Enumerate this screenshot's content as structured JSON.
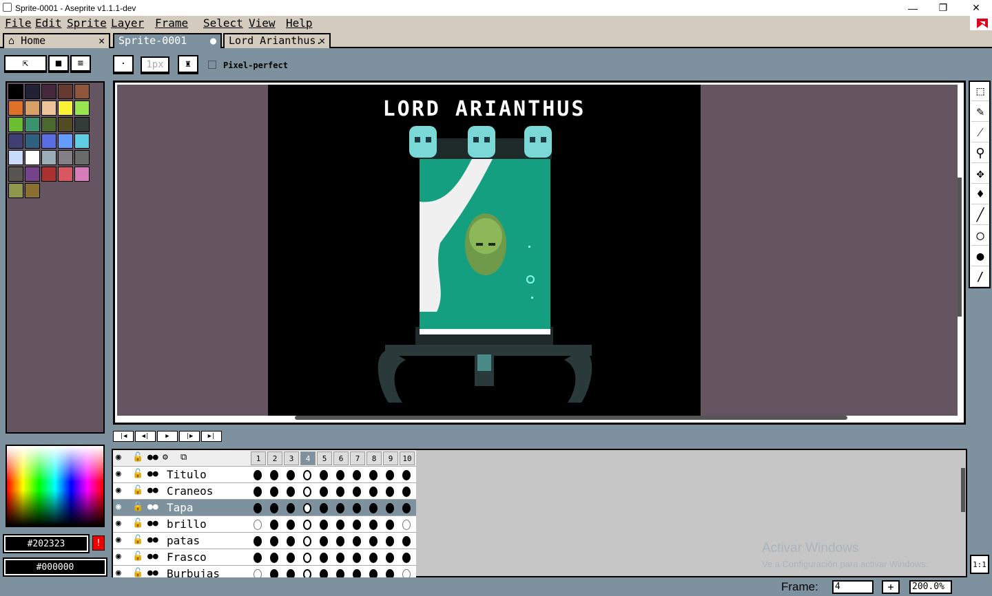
{
  "window": {
    "title": "Sprite-0001 - Aseprite v1.1.1-dev",
    "min": "—",
    "max": "❐",
    "close": "✕"
  },
  "menu": [
    "File",
    "Edit",
    "Sprite",
    "Layer",
    "Frame",
    "Select",
    "View",
    "Help"
  ],
  "tabs": [
    {
      "label": "Home",
      "close": "✕"
    },
    {
      "label": "Sprite-0001",
      "close": "●"
    },
    {
      "label": "Lord Arianthus.",
      "close": "✕"
    }
  ],
  "tool_options": {
    "brush_size": "1px",
    "pixel_perfect_label": "Pixel-perfect"
  },
  "palette": [
    "#000000",
    "#222034",
    "#45283c",
    "#663931",
    "#8f563b",
    "#df7126",
    "#d9a066",
    "#eec39a",
    "#fbf236",
    "#99e550",
    "#6abe30",
    "#37946e",
    "#4b692f",
    "#524b24",
    "#323c39",
    "#3f3f74",
    "#306082",
    "#5b6ee1",
    "#639bff",
    "#5fcde4",
    "#cbdbfc",
    "#ffffff",
    "#9badb7",
    "#847e87",
    "#696a6a",
    "#595652",
    "#76428a",
    "#ac3232",
    "#d95763",
    "#d77bba",
    "#8f974a",
    "#8a6f30"
  ],
  "colors": {
    "foreground": "#202323",
    "background": "#000000"
  },
  "sprite": {
    "title": "LORD ARIANTHUS"
  },
  "tools": [
    "marquee-icon",
    "pencil-icon",
    "eyedropper-icon",
    "zoom-icon",
    "move-icon",
    "bucket-icon",
    "line-icon",
    "ellipse-icon",
    "blur-icon",
    "spray-icon"
  ],
  "timeline": {
    "frames": [
      "1",
      "2",
      "3",
      "4",
      "5",
      "6",
      "7",
      "8",
      "9",
      "10"
    ],
    "current_frame": 4,
    "layers": [
      {
        "name": "Titulo",
        "cels": "xxxhxxxxxx",
        "selected": false
      },
      {
        "name": "Craneos",
        "cels": "xxxhxxxxxx",
        "selected": false
      },
      {
        "name": "Tapa",
        "cels": "xxxhxxxxxx",
        "selected": true
      },
      {
        "name": "brillo",
        "cels": "oxxhxxxxxo",
        "selected": false
      },
      {
        "name": "patas",
        "cels": "xxxhxxxxxx",
        "selected": false
      },
      {
        "name": "Frasco",
        "cels": "xxxhxxxxxx",
        "selected": false
      },
      {
        "name": "Burbujas",
        "cels": "oxxhxxxxxo",
        "selected": false
      }
    ]
  },
  "status": {
    "frame_label": "Frame:",
    "frame_value": "4",
    "zoom": "200.0%",
    "zoom_reset": "1:1",
    "plus": "+"
  },
  "watermark": {
    "line1": "Activar Windows",
    "line2": "Ve a Configuración para activar Windows."
  }
}
